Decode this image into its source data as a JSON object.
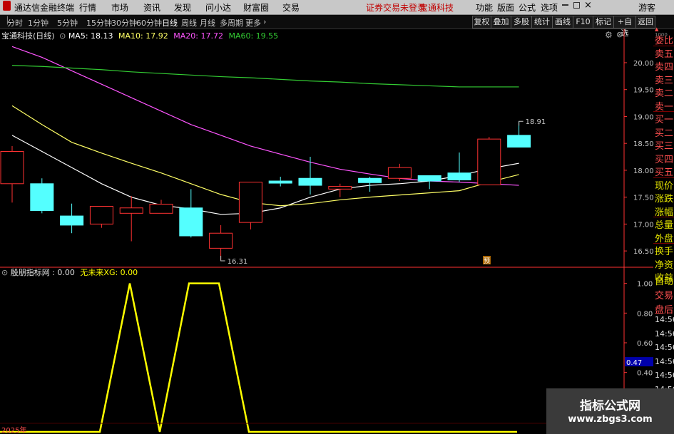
{
  "menubar": {
    "app_title": "通达信金融终端",
    "menus": [
      "行情",
      "市场",
      "资讯",
      "发现",
      "问小达",
      "财富圈",
      "交易"
    ],
    "notice": "证券交易未登录",
    "stock_name": "宝通科技",
    "right_menus": [
      "功能",
      "版面",
      "公式",
      "选项"
    ],
    "user": "游客"
  },
  "periodbar": {
    "periods": [
      "分时",
      "1分钟",
      "5分钟",
      "15分钟",
      "30分钟",
      "60分钟",
      "日线",
      "周线",
      "月线",
      "多周期",
      "更多"
    ],
    "active_period": "日线",
    "tools": [
      "复权",
      "叠加",
      "多股",
      "统计",
      "画线",
      "F10",
      "标记",
      "+自选",
      "返回"
    ]
  },
  "main_info": {
    "title": "宝通科技(日线)",
    "ma5": "MA5: 18.13",
    "ma10": "MA10: 17.92",
    "ma20": "MA20: 17.72",
    "ma60": "MA60: 19.55"
  },
  "indicator_info": {
    "name": "殷朋指标网 : 0.00",
    "line": "无未来XG: 0.00"
  },
  "annotations": {
    "low": "16.31",
    "high": "18.91",
    "forecast_tag": "预",
    "year": "2025年"
  },
  "right_panel": {
    "labels": [
      "委比",
      "卖五",
      "卖四",
      "卖三",
      "卖二",
      "卖一",
      "买一",
      "买二",
      "买三",
      "买四",
      "买五",
      "现价",
      "涨跌",
      "涨幅",
      "总量",
      "外盘",
      "换手",
      "净资",
      "收益"
    ],
    "lower_labels": [
      "自动",
      "交易",
      "盘后"
    ],
    "times": [
      "14:56",
      "14:56",
      "14:56",
      "14:56",
      "14:56",
      "14:56",
      "14:56",
      "14:56"
    ],
    "top_value": "1000"
  },
  "watermark": {
    "title": "指标公式网",
    "url": "www.zbgs3.com"
  },
  "colors": {
    "up": "#ff3232",
    "down": "#54ffff",
    "ma5": "#ffffff",
    "ma10": "#ffff66",
    "ma20": "#ff55ff",
    "ma60": "#33cc33",
    "indicator": "#ffff00",
    "axis": "#ff3232"
  },
  "chart_data": [
    {
      "type": "candlestick",
      "title": "宝通科技(日线)",
      "ylim": [
        16.25,
        20.45
      ],
      "yticks": [
        16.5,
        17.0,
        17.5,
        18.0,
        18.5,
        19.0,
        19.5,
        20.0
      ],
      "candles": [
        {
          "o": 17.75,
          "c": 18.35,
          "h": 18.45,
          "l": 17.4
        },
        {
          "o": 17.75,
          "c": 17.25,
          "h": 17.85,
          "l": 17.2
        },
        {
          "o": 17.15,
          "c": 16.98,
          "h": 17.38,
          "l": 16.83
        },
        {
          "o": 17.0,
          "c": 17.33,
          "h": 17.33,
          "l": 16.93
        },
        {
          "o": 17.2,
          "c": 17.3,
          "h": 17.52,
          "l": 16.68
        },
        {
          "o": 17.2,
          "c": 17.37,
          "h": 17.45,
          "l": 17.2
        },
        {
          "o": 17.3,
          "c": 16.78,
          "h": 17.65,
          "l": 16.75
        },
        {
          "o": 16.55,
          "c": 16.83,
          "h": 16.98,
          "l": 16.33
        },
        {
          "o": 17.03,
          "c": 17.78,
          "h": 17.78,
          "l": 16.9
        },
        {
          "o": 17.8,
          "c": 17.76,
          "h": 17.88,
          "l": 17.7
        },
        {
          "o": 17.85,
          "c": 17.72,
          "h": 18.25,
          "l": 17.55
        },
        {
          "o": 17.65,
          "c": 17.7,
          "h": 17.75,
          "l": 17.5
        },
        {
          "o": 17.85,
          "c": 17.77,
          "h": 17.88,
          "l": 17.6
        },
        {
          "o": 17.85,
          "c": 18.05,
          "h": 18.12,
          "l": 17.8
        },
        {
          "o": 17.9,
          "c": 17.8,
          "h": 17.9,
          "l": 17.65
        },
        {
          "o": 17.95,
          "c": 17.82,
          "h": 18.33,
          "l": 17.78
        },
        {
          "o": 17.73,
          "c": 18.58,
          "h": 18.62,
          "l": 17.73
        },
        {
          "o": 18.65,
          "c": 18.43,
          "h": 18.91,
          "l": 18.43
        }
      ],
      "series": [
        {
          "name": "MA5",
          "values": [
            18.65,
            18.35,
            18.05,
            17.75,
            17.5,
            17.35,
            17.28,
            17.18,
            17.2,
            17.3,
            17.5,
            17.65,
            17.72,
            17.75,
            17.8,
            17.9,
            18.03,
            18.13
          ]
        },
        {
          "name": "MA10",
          "values": [
            19.2,
            18.85,
            18.52,
            18.32,
            18.13,
            17.95,
            17.75,
            17.55,
            17.4,
            17.34,
            17.38,
            17.45,
            17.5,
            17.54,
            17.58,
            17.62,
            17.78,
            17.92
          ]
        },
        {
          "name": "MA20",
          "values": [
            20.3,
            20.1,
            19.85,
            19.6,
            19.35,
            19.1,
            18.85,
            18.65,
            18.45,
            18.3,
            18.15,
            18.02,
            17.93,
            17.85,
            17.8,
            17.78,
            17.75,
            17.72
          ]
        },
        {
          "name": "MA60",
          "values": [
            19.95,
            19.93,
            19.9,
            19.87,
            19.83,
            19.8,
            19.77,
            19.74,
            19.72,
            19.69,
            19.66,
            19.64,
            19.61,
            19.59,
            19.57,
            19.55,
            19.55,
            19.55
          ]
        }
      ]
    },
    {
      "type": "line",
      "title": "殷朋指标网",
      "ylim": [
        0,
        1.08
      ],
      "yticks": [
        0.2,
        0.4,
        0.6,
        0.8,
        1.0
      ],
      "current_value_tag": "0.47",
      "series": [
        {
          "name": "无未来XG",
          "points": [
            [
              0,
              0
            ],
            [
              3,
              0
            ],
            [
              4,
              1
            ],
            [
              5,
              0
            ],
            [
              6,
              1
            ],
            [
              7,
              1
            ],
            [
              8,
              0
            ],
            [
              17,
              0
            ]
          ]
        }
      ]
    }
  ]
}
